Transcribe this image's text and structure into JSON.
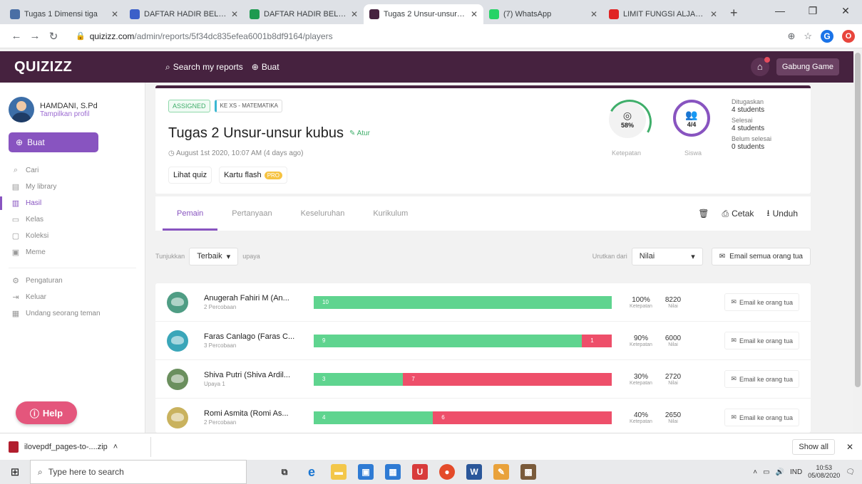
{
  "browser": {
    "tabs": [
      {
        "title": "Tugas 1 Dimensi tiga",
        "color": "#4a6fa5",
        "active": false
      },
      {
        "title": "DAFTAR HADIR BELAJ...",
        "color": "#3b5fc9",
        "active": false
      },
      {
        "title": "DAFTAR HADIR BELAJ...",
        "color": "#1e9a50",
        "active": false
      },
      {
        "title": "Tugas 2 Unsur-unsur k...",
        "color": "#46223f",
        "active": true
      },
      {
        "title": "(7) WhatsApp",
        "color": "#25d366",
        "active": false
      },
      {
        "title": "LIMIT FUNGSI ALJABA...",
        "color": "#e02424",
        "active": false
      }
    ],
    "new_tab": "+",
    "url_host": "quizizz.com",
    "url_path": "/admin/reports/5f34dc835efea6001b8df9164/players",
    "ext1": "G",
    "ext2": "O"
  },
  "app": {
    "logo": "QUIZIZZ",
    "search_link": "Search my reports",
    "create_link": "Buat",
    "join_button": "Gabung Game"
  },
  "sidebar": {
    "user_name": "HAMDANI, S.Pd",
    "user_link": "Tampilkan profil",
    "create_button": "Buat",
    "items": [
      {
        "label": "Cari",
        "icon": "⌕",
        "active": false
      },
      {
        "label": "My library",
        "icon": "▤",
        "active": false
      },
      {
        "label": "Hasil",
        "icon": "▥",
        "active": true
      },
      {
        "label": "Kelas",
        "icon": "▭",
        "active": false
      },
      {
        "label": "Koleksi",
        "icon": "▢",
        "active": false
      },
      {
        "label": "Meme",
        "icon": "▣",
        "active": false
      }
    ],
    "items2": [
      {
        "label": "Pengaturan",
        "icon": "⚙"
      },
      {
        "label": "Keluar",
        "icon": "⇥"
      },
      {
        "label": "Undang seorang teman",
        "icon": "▦"
      }
    ],
    "help_button": "Help"
  },
  "quiz": {
    "tag_assigned": "ASSIGNED",
    "tag_class": "KE XS - MATEMATIKA",
    "title": "Tugas 2 Unsur-unsur kubus",
    "edit_label": "Atur",
    "date": "August 1st 2020, 10:07 AM (4 days ago)",
    "btn_view": "Lihat quiz",
    "btn_flash": "Kartu flash",
    "btn_flash_badge": "PRO",
    "accuracy_value": "58%",
    "accuracy_label": "Ketepatan",
    "students_value": "4/4",
    "students_label": "Siswa",
    "summary": [
      {
        "label": "Ditugaskan",
        "value": "4 students"
      },
      {
        "label": "Selesai",
        "value": "4 students"
      },
      {
        "label": "Belum selesai",
        "value": "0 students"
      }
    ]
  },
  "report_tabs": {
    "tabs": [
      {
        "label": "Pemain",
        "active": true
      },
      {
        "label": "Pertanyaan",
        "active": false
      },
      {
        "label": "Keseluruhan",
        "active": false
      },
      {
        "label": "Kurikulum",
        "active": false
      }
    ],
    "print": "Cetak",
    "download": "Unduh"
  },
  "filters": {
    "show_label": "Tunjukkan",
    "show_value": "Terbaik",
    "attempt_label": "upaya",
    "sort_label": "Urutkan dari",
    "sort_value": "Nilai",
    "email_all": "Email semua orang tua"
  },
  "players": [
    {
      "name": "Anugerah Fahiri M (An...",
      "sub": "2 Percobaan",
      "correct": 10,
      "incorrect": 0,
      "correct_label": "10",
      "incorrect_label": "",
      "accuracy": "100%",
      "score": "8220",
      "avatar": "#4f9d84",
      "email": "Email ke orang tua"
    },
    {
      "name": "Faras Canlago (Faras C...",
      "sub": "3 Percobaan",
      "correct": 9,
      "incorrect": 1,
      "correct_label": "9",
      "incorrect_label": "1",
      "accuracy": "90%",
      "score": "6000",
      "avatar": "#3aa6b9",
      "email": "Email ke orang tua"
    },
    {
      "name": "Shiva Putri (Shiva Ardil...",
      "sub": "Upaya 1",
      "correct": 3,
      "incorrect": 7,
      "correct_label": "3",
      "incorrect_label": "7",
      "accuracy": "30%",
      "score": "2720",
      "avatar": "#6b8f5e",
      "email": "Email ke orang tua"
    },
    {
      "name": "Romi Asmita (Romi As...",
      "sub": "2 Percobaan",
      "correct": 4,
      "incorrect": 6,
      "correct_label": "4",
      "incorrect_label": "6",
      "accuracy": "40%",
      "score": "2650",
      "avatar": "#c9b25e",
      "email": "Email ke orang tua"
    }
  ],
  "labels": {
    "accuracy": "Ketepatan",
    "score": "Nilai"
  },
  "download_bar": {
    "file": "ilovepdf_pages-to-....zip",
    "show_all": "Show all"
  },
  "taskbar": {
    "search_placeholder": "Type here to search",
    "time": "10:53",
    "date": "05/08/2020",
    "lang": "IND"
  }
}
